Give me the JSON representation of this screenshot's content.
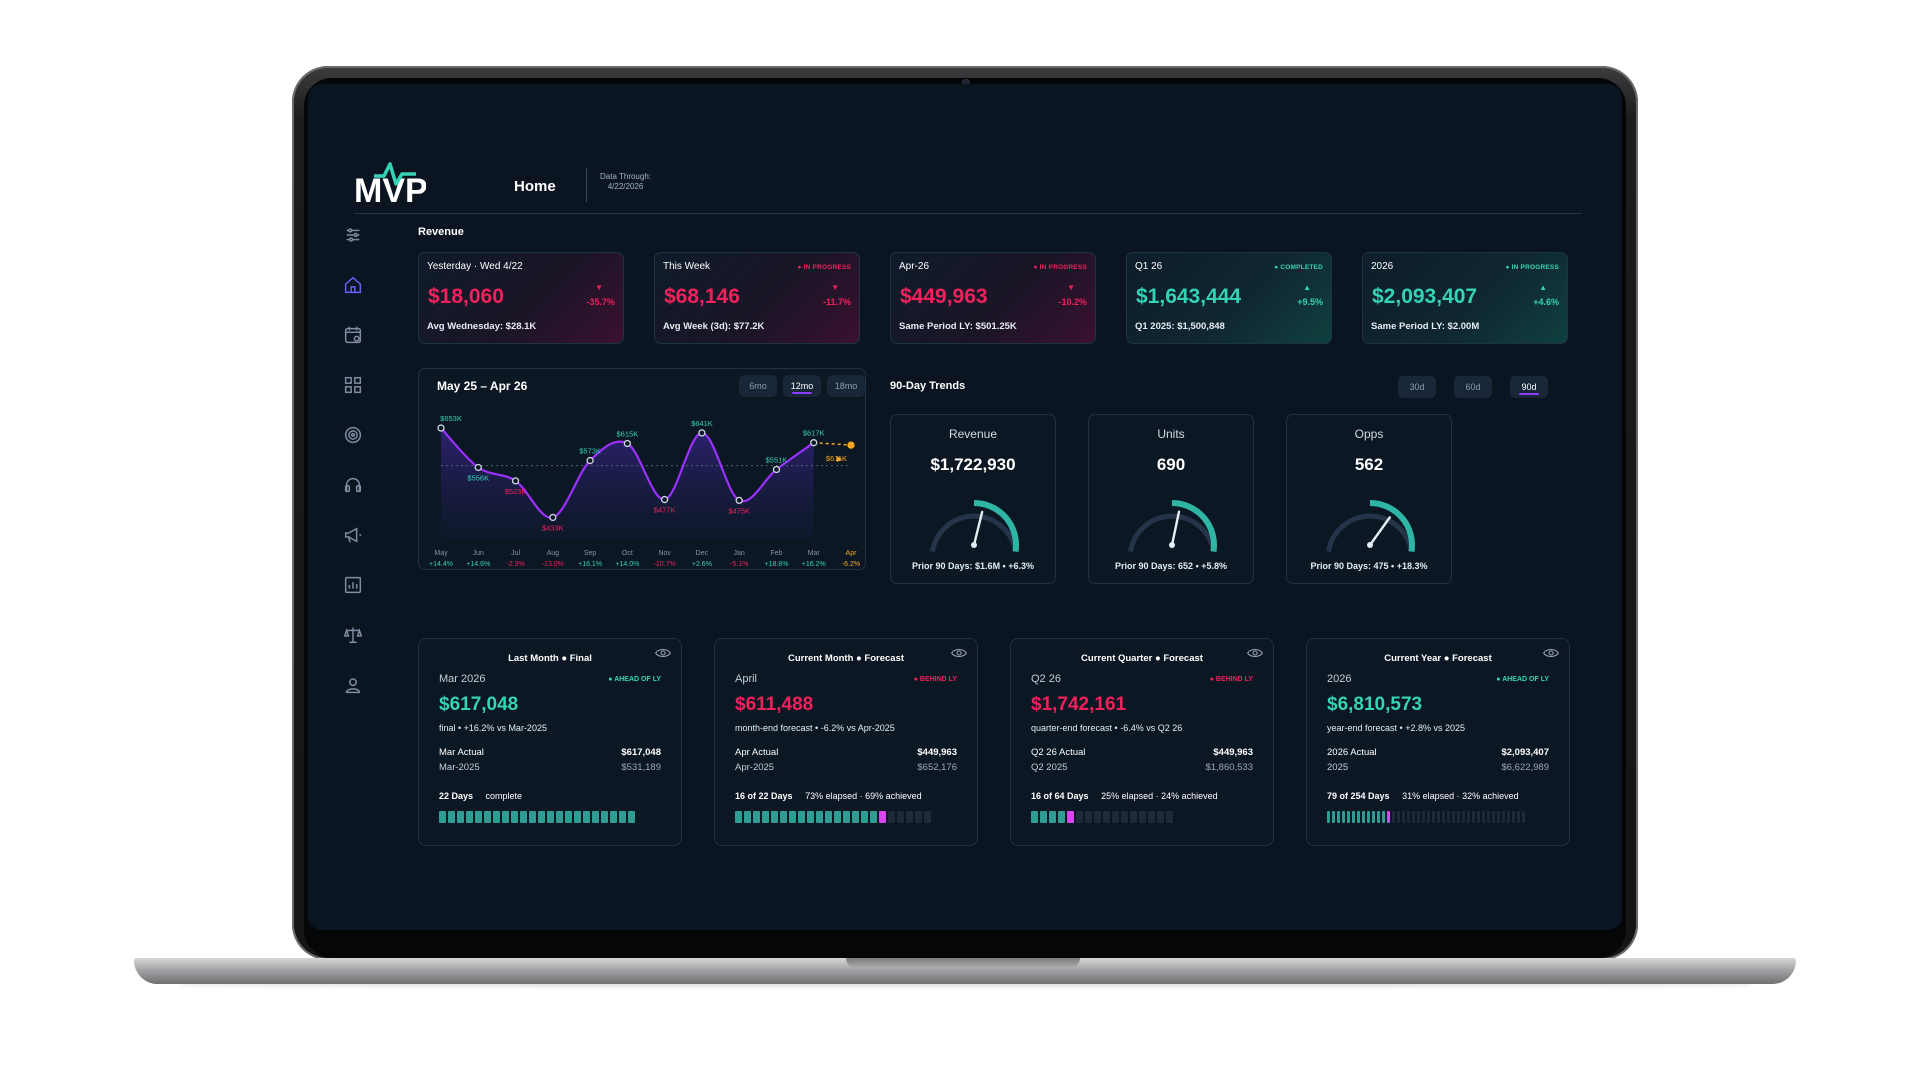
{
  "header": {
    "logo_text": "MVP",
    "title": "Home",
    "data_through_label": "Data Through:",
    "data_through_date": "4/22/2026"
  },
  "sidebar": {
    "icons": [
      "sliders-icon",
      "home-icon",
      "calendar-icon",
      "grid-icon",
      "target-icon",
      "headset-icon",
      "megaphone-icon",
      "report-icon",
      "scales-icon",
      "profile-icon"
    ]
  },
  "revenue": {
    "section_title": "Revenue",
    "cards": [
      {
        "title": "Yesterday · Wed 4/22",
        "status": "",
        "value": "$18,060",
        "change": "-35.7%",
        "direction": "down",
        "sub": "Avg Wednesday: $28.1K",
        "tone": "red"
      },
      {
        "title": "This Week",
        "status": "● IN PROGRESS",
        "value": "$68,146",
        "change": "-11.7%",
        "direction": "down",
        "sub": "Avg Week (3d): $77.2K",
        "tone": "red"
      },
      {
        "title": "Apr-26",
        "status": "● IN PROGRESS",
        "value": "$449,963",
        "change": "-10.2%",
        "direction": "down",
        "sub": "Same Period LY: $501.25K",
        "tone": "red"
      },
      {
        "title": "Q1 26",
        "status": "● COMPLETED",
        "value": "$1,643,444",
        "change": "+9.5%",
        "direction": "up",
        "sub": "Q1 2025: $1,500,848",
        "tone": "teal"
      },
      {
        "title": "2026",
        "status": "● IN PROGRESS",
        "value": "$2,093,407",
        "change": "+4.6%",
        "direction": "up",
        "sub": "Same Period LY: $2.00M",
        "tone": "teal"
      }
    ]
  },
  "chart_panel": {
    "title": "May 25 – Apr 26",
    "ranges": [
      "6mo",
      "12mo",
      "18mo"
    ],
    "active_range": "12mo"
  },
  "chart_data": {
    "type": "line",
    "categories": [
      "May",
      "Jun",
      "Jul",
      "Aug",
      "Sep",
      "Oct",
      "Nov",
      "Dec",
      "Jan",
      "Feb",
      "Mar",
      "Apr"
    ],
    "values": [
      653,
      556,
      523,
      433,
      573,
      615,
      477,
      641,
      475,
      551,
      617,
      611
    ],
    "value_labels": [
      "$653K",
      "$556K",
      "$523K",
      "$433K",
      "$573K",
      "$615K",
      "$477K",
      "$641K",
      "$475K",
      "$551K",
      "$617K",
      "$611K"
    ],
    "yoy_changes": [
      "+14.4%",
      "+14.6%",
      "-2.3%",
      "-13.0%",
      "+16.1%",
      "+14.0%",
      "-10.7%",
      "+2.6%",
      "-5.1%",
      "+18.8%",
      "+16.2%",
      "-6.2%"
    ],
    "forecast_index": 11,
    "ylim": [
      380,
      690
    ],
    "colors": {
      "line": "#9b30ff",
      "up": "#35d3b6",
      "down": "#f0215b",
      "forecast": "#f5a623"
    }
  },
  "trends": {
    "title": "90-Day Trends",
    "ranges": [
      "30d",
      "60d",
      "90d"
    ],
    "active_range": "90d",
    "gauges": [
      {
        "label": "Revenue",
        "value": "$1,722,930",
        "prior": "Prior 90 Days: $1.6M • +6.3%",
        "ratio": 0.57
      },
      {
        "label": "Units",
        "value": "690",
        "prior": "Prior 90 Days: 652 • +5.8%",
        "ratio": 0.56
      },
      {
        "label": "Opps",
        "value": "562",
        "prior": "Prior 90 Days: 475 • +18.3%",
        "ratio": 0.68
      }
    ]
  },
  "period_cards": [
    {
      "head": "Last Month ● Final",
      "period": "Mar 2026",
      "status": "● AHEAD OF LY",
      "tone": "teal",
      "value": "$617,048",
      "sub": "final • +16.2% vs Mar-2025",
      "row1_label": "Mar Actual",
      "row1_value": "$617,048",
      "row2_label": "Mar-2025",
      "row2_value": "$531,189",
      "days": "22 Days",
      "progress_text": "complete",
      "segments": 22,
      "filled": 22,
      "current": false
    },
    {
      "head": "Current Month ● Forecast",
      "period": "April",
      "status": "● BEHIND LY",
      "tone": "red",
      "value": "$611,488",
      "sub": "month-end forecast • -6.2% vs Apr-2025",
      "row1_label": "Apr Actual",
      "row1_value": "$449,963",
      "row2_label": "Apr-2025",
      "row2_value": "$652,176",
      "days": "16 of 22 Days",
      "progress_text": "73% elapsed · 69% achieved",
      "segments": 22,
      "filled": 16,
      "current": true
    },
    {
      "head": "Current Quarter ● Forecast",
      "period": "Q2 26",
      "status": "● BEHIND LY",
      "tone": "red",
      "value": "$1,742,161",
      "sub": "quarter-end forecast • -6.4% vs Q2 26",
      "row1_label": "Q2 26 Actual",
      "row1_value": "$449,963",
      "row2_label": "Q2 2025",
      "row2_value": "$1,860,533",
      "days": "16 of 64 Days",
      "progress_text": "25% elapsed · 24% achieved",
      "segments": 16,
      "filled": 4,
      "current": true
    },
    {
      "head": "Current Year ● Forecast",
      "period": "2026",
      "status": "● AHEAD OF LY",
      "tone": "teal",
      "value": "$6,810,573",
      "sub": "year-end forecast • +2.8% vs 2025",
      "row1_label": "2026 Actual",
      "row1_value": "$2,093,407",
      "row2_label": "2025",
      "row2_value": "$6,622,989",
      "days": "79 of 254 Days",
      "progress_text": "31% elapsed · 32% achieved",
      "segments": 40,
      "filled": 12,
      "current": true
    }
  ]
}
